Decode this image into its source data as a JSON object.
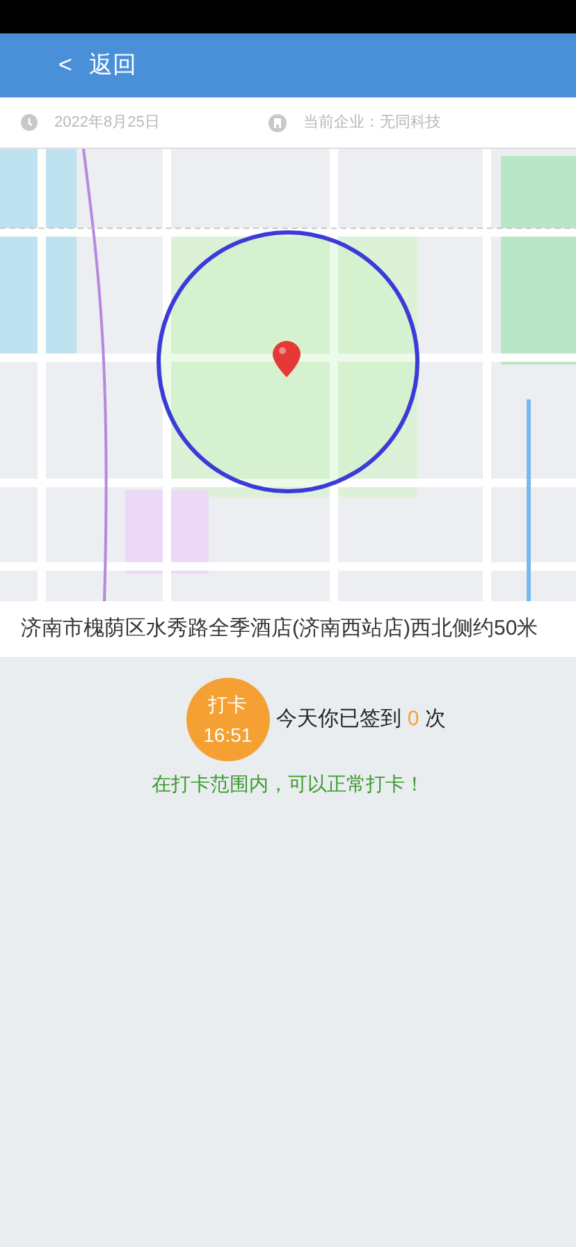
{
  "header": {
    "back_icon": "<",
    "title": "返回"
  },
  "info_bar": {
    "date": "2022年8月25日",
    "company": "当前企业：无同科技"
  },
  "address": "济南市槐荫区水秀路全季酒店(济南西站店)西北侧约50米",
  "punch": {
    "button_label": "打卡",
    "button_time": "16:51",
    "count_prefix": "今天你已签到",
    "count": "0",
    "count_suffix": "次",
    "in_range": true,
    "message": "在打卡范围内，可以正常打卡！"
  }
}
